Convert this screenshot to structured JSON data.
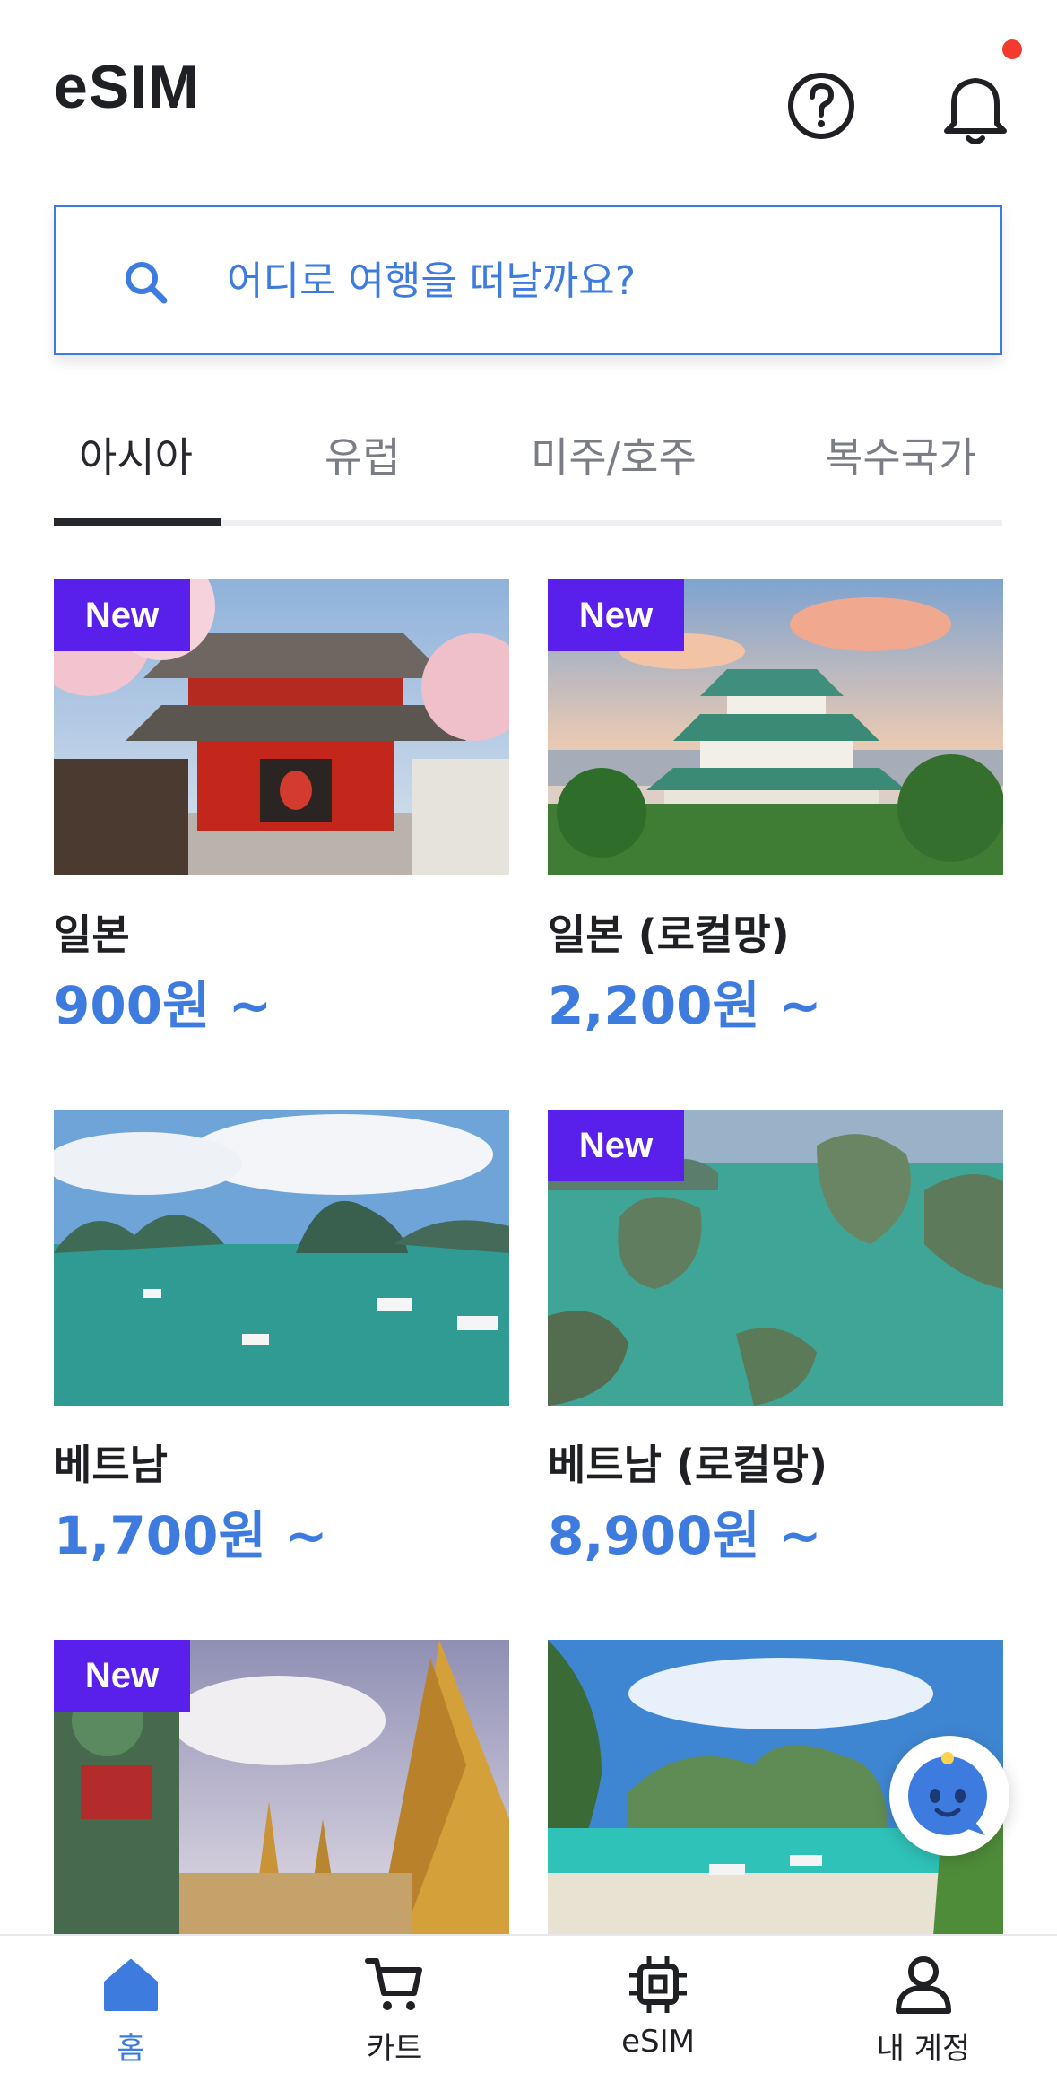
{
  "header": {
    "title": "eSIM",
    "help_icon": "question-circle-icon",
    "bell_icon": "bell-icon",
    "has_notification": true
  },
  "search": {
    "placeholder": "어디로 여행을 떠날까요?",
    "icon": "search-icon"
  },
  "tabs": [
    {
      "label": "아시아",
      "active": true
    },
    {
      "label": "유럽",
      "active": false
    },
    {
      "label": "미주/호주",
      "active": false
    },
    {
      "label": "복수국가",
      "active": false
    }
  ],
  "cards": [
    {
      "name": "일본",
      "price": "900원 ~",
      "badge": "New"
    },
    {
      "name": "일본 (로컬망)",
      "price": "2,200원 ~",
      "badge": "New"
    },
    {
      "name": "베트남",
      "price": "1,700원 ~",
      "badge": ""
    },
    {
      "name": "베트남 (로컬망)",
      "price": "8,900원 ~",
      "badge": "New"
    },
    {
      "name": "",
      "price": "",
      "badge": "New"
    },
    {
      "name": "",
      "price": "",
      "badge": ""
    }
  ],
  "bottom_nav": [
    {
      "label": "홈",
      "icon": "home-icon",
      "active": true
    },
    {
      "label": "카트",
      "icon": "cart-icon",
      "active": false
    },
    {
      "label": "eSIM",
      "icon": "chip-icon",
      "active": false
    },
    {
      "label": "내 계정",
      "icon": "user-icon",
      "active": false
    }
  ],
  "colors": {
    "accent": "#3e7be0",
    "badge": "#5a20eb",
    "notification": "#f23a2f"
  }
}
